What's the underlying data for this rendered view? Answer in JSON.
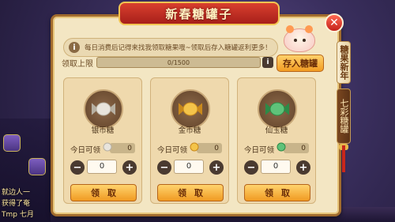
{
  "title": "新春糖罐子",
  "close_label": "✕",
  "info": {
    "icon": "i",
    "text": "每日消费后记得来找我领取糖果哦~领取后存入糖罐返利更多！"
  },
  "limit": {
    "label": "领取上限",
    "value_text": "0/1500",
    "progress": 0,
    "info_icon": "i"
  },
  "deposit_button": "存入糖罐",
  "tabs": [
    {
      "label": "糖果新年",
      "active": true
    },
    {
      "label": "七彩糖罐",
      "active": false
    }
  ],
  "cards": [
    {
      "name": "银币糖",
      "daily_label": "今日可领",
      "daily_count": "0",
      "quantity": "0",
      "minus": "−",
      "plus": "+",
      "claim_label": "领取",
      "candy_color": "#e8e4dc",
      "candy_accent": "#b7b0a2"
    },
    {
      "name": "金币糖",
      "daily_label": "今日可领",
      "daily_count": "0",
      "quantity": "0",
      "minus": "−",
      "plus": "+",
      "claim_label": "领取",
      "candy_color": "#f4c44a",
      "candy_accent": "#c9891c"
    },
    {
      "name": "仙玉糖",
      "daily_label": "今日可领",
      "daily_count": "0",
      "quantity": "0",
      "minus": "−",
      "plus": "+",
      "claim_label": "领取",
      "candy_color": "#5fc27a",
      "candy_accent": "#2d8a47"
    }
  ],
  "background_chat": [
    "就边人一",
    "获得了奄",
    "Tmp 七月"
  ]
}
